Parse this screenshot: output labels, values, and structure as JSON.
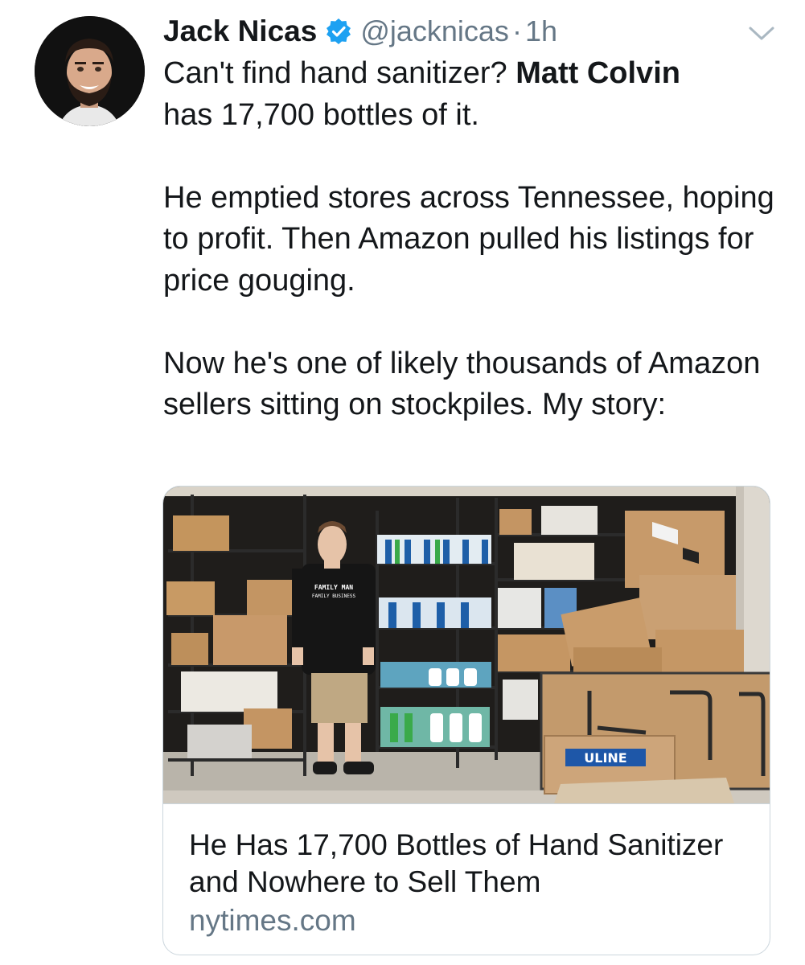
{
  "tweet": {
    "author_name": "Jack Nicas",
    "handle": "@jacknicas",
    "separator": "·",
    "time": "1h",
    "text_part1": "Can't find hand sanitizer? ",
    "text_bold": "Matt Colvin",
    "text_part2": "\nhas 17,700 bottles of it.\n\nHe emptied stores across Tennessee, hoping to profit. Then Amazon pulled his listings for price gouging.\n\nNow he's one of likely thousands of Amazon sellers sitting on stockpiles. My story:"
  },
  "card": {
    "title": "He Has 17,700 Bottles of Hand Sanitizer and Nowhere to Sell Them",
    "domain": "nytimes.com",
    "photo_shirt_text": "FAMILY MAN",
    "photo_shirt_subtext": "FAMILY BUSINESS",
    "photo_box_brand": "ULINE"
  },
  "icons": {
    "avatar": "avatar-photo",
    "verified": "verified-badge-icon",
    "menu": "chevron-down-icon"
  },
  "colors": {
    "verified": "#1da1f2",
    "secondary_text": "#657786",
    "primary_text": "#14171a",
    "card_border": "#ccd6dd"
  }
}
